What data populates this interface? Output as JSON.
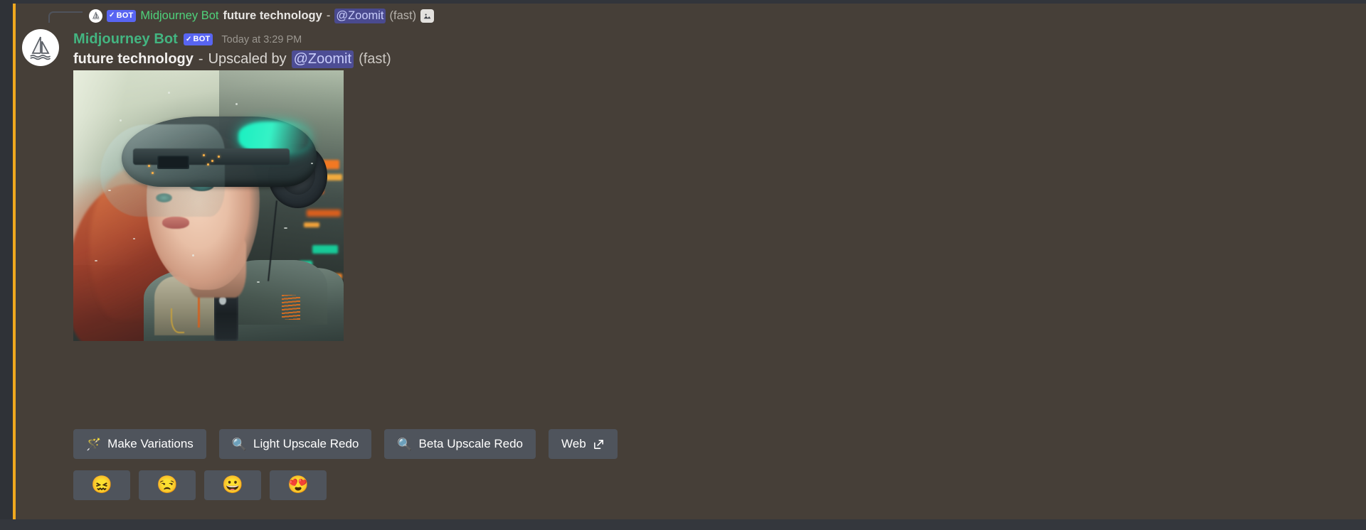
{
  "reply_reference": {
    "avatar_icon": "midjourney-sailboat-icon",
    "bot_badge": "BOT",
    "bot_badge_check": "✓",
    "author": "Midjourney Bot",
    "prompt": "future technology",
    "separator": "-",
    "mention": "@Zoomit",
    "speed": "(fast)",
    "attachment_icon": "image-attachment-icon"
  },
  "message": {
    "avatar_icon": "midjourney-sailboat-icon",
    "author": "Midjourney Bot",
    "bot_badge": "BOT",
    "bot_badge_check": "✓",
    "timestamp": "Today at 3:29 PM",
    "prompt": "future technology",
    "separator": "-",
    "action_text": "Upscaled by",
    "mention": "@Zoomit",
    "speed": "(fast)"
  },
  "attachment": {
    "name": "upscaled-artwork",
    "alt": "Cyberpunk girl with AR visor goggles and headphones, red hair, neon city background"
  },
  "action_buttons": [
    {
      "name": "make-variations-button",
      "icon": "sparkle-wand-icon",
      "emoji": "🪄",
      "label": "Make Variations"
    },
    {
      "name": "light-upscale-redo-button",
      "icon": "magnifying-glass-icon",
      "emoji": "🔍",
      "label": "Light Upscale Redo"
    },
    {
      "name": "beta-upscale-redo-button",
      "icon": "magnifying-glass-icon",
      "emoji": "🔍",
      "label": "Beta Upscale Redo"
    },
    {
      "name": "web-button",
      "icon": "external-link-icon",
      "emoji": "",
      "label": "Web"
    }
  ],
  "reaction_buttons": [
    {
      "name": "reaction-confounded",
      "emoji": "😖"
    },
    {
      "name": "reaction-disappointed",
      "emoji": "😒"
    },
    {
      "name": "reaction-grinning",
      "emoji": "😀"
    },
    {
      "name": "reaction-heart-eyes",
      "emoji": "😍"
    }
  ],
  "colors": {
    "mention_bar": "#f0a81f",
    "highlight_bg": "#463f38",
    "bot_badge_bg": "#5865f2",
    "author_green": "#43b581",
    "mention_bg": "#4d4d94",
    "button_bg": "#4f545c"
  }
}
